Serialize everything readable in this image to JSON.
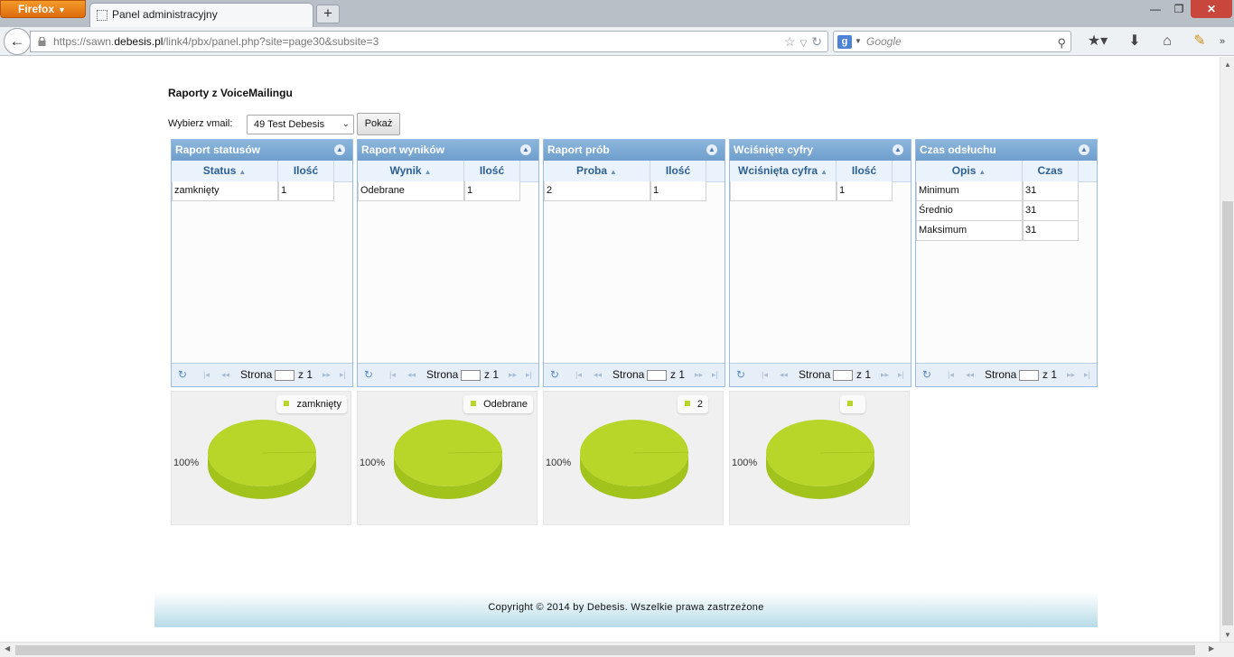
{
  "browser": {
    "menu_label": "Firefox",
    "tab_title": "Panel administracyjny",
    "newtab_label": "+",
    "url_prefix": "https://sawn.",
    "url_host": "debesis.pl",
    "url_path": "/link4/pbx/panel.php?site=page30&subsite=3",
    "search_placeholder": "Google"
  },
  "page": {
    "title": "Raporty z VoiceMailingu",
    "vmail_label": "Wybierz vmail:",
    "vmail_selected": "49 Test Debesis",
    "show_button": "Pokaż"
  },
  "pager": {
    "page_label": "Strona",
    "of_label": "z 1"
  },
  "grids": [
    {
      "title": "Raport statusów",
      "columns": [
        "Status",
        "Ilość"
      ],
      "rows": [
        [
          "zamknięty",
          "1"
        ]
      ]
    },
    {
      "title": "Raport wyników",
      "columns": [
        "Wynik",
        "Ilość"
      ],
      "rows": [
        [
          "Odebrane",
          "1"
        ]
      ]
    },
    {
      "title": "Raport prób",
      "columns": [
        "Proba",
        "Ilość"
      ],
      "rows": [
        [
          "2",
          "1"
        ]
      ]
    },
    {
      "title": "Wciśnięte cyfry",
      "columns": [
        "Wciśnięta cyfra",
        "Ilość"
      ],
      "rows": [
        [
          "",
          "1"
        ]
      ]
    },
    {
      "title": "Czas odsłuchu",
      "columns": [
        "Opis",
        "Czas"
      ],
      "rows": [
        [
          "Minimum",
          "31"
        ],
        [
          "Średnio",
          "31"
        ],
        [
          "Maksimum",
          "31"
        ]
      ]
    }
  ],
  "chart_data": [
    {
      "type": "pie",
      "legend": [
        "zamknięty"
      ],
      "values": [
        1
      ],
      "slice_labels": [
        "100%"
      ],
      "color": "#b8d62a"
    },
    {
      "type": "pie",
      "legend": [
        "Odebrane"
      ],
      "values": [
        1
      ],
      "slice_labels": [
        "100%"
      ],
      "color": "#b8d62a"
    },
    {
      "type": "pie",
      "legend": [
        "2"
      ],
      "values": [
        1
      ],
      "slice_labels": [
        "100%"
      ],
      "color": "#b8d62a"
    },
    {
      "type": "pie",
      "legend": [
        ""
      ],
      "values": [
        1
      ],
      "slice_labels": [
        "100%"
      ],
      "color": "#b8d62a"
    }
  ],
  "footer": {
    "text": "Copyright © 2014 by Debesis. Wszelkie prawa zastrzeżone"
  },
  "colors": {
    "header_blue": "#7fabd6",
    "pie_green": "#b8d62a",
    "firefox_orange": "#e8801a"
  }
}
